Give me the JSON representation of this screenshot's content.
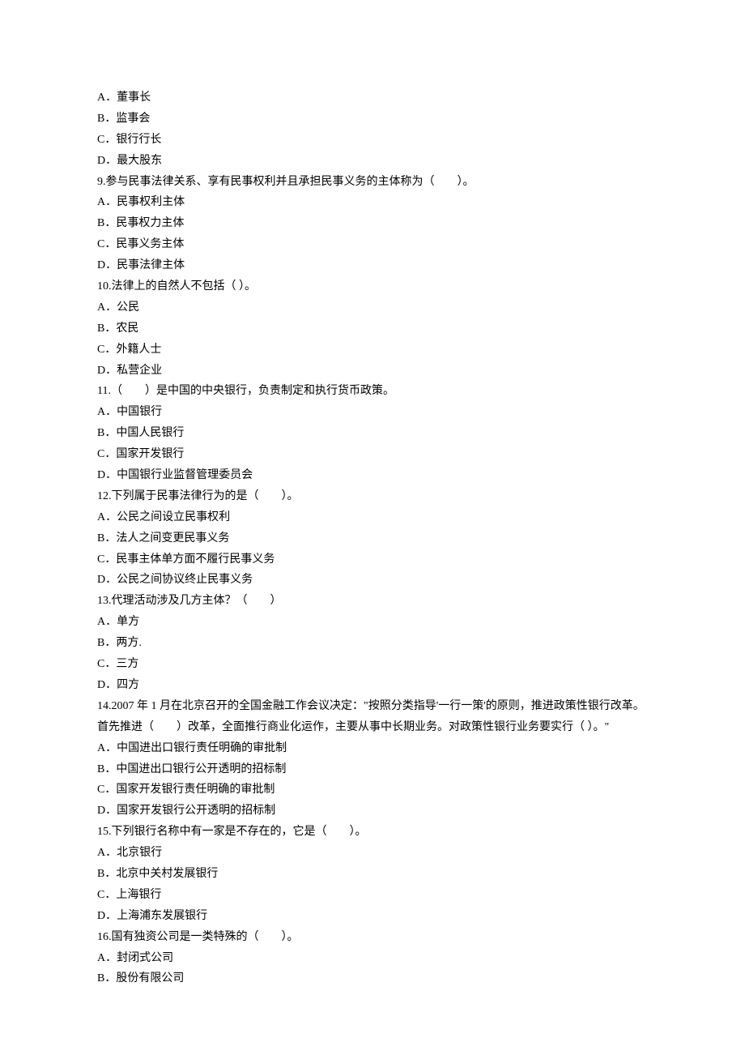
{
  "lines": [
    "A．董事长",
    "B．监事会",
    "C．银行行长",
    "D．最大股东",
    "9.参与民事法律关系、享有民事权利并且承担民事义务的主体称为（　　）。",
    "A．民事权利主体",
    "B．民事权力主体",
    "C．民事义务主体",
    "D．民事法律主体",
    "10.法律上的自然人不包括（ ）。",
    "A．公民",
    "B．农民",
    "C．外籍人士",
    "D．私营企业",
    "11.（　　）是中国的中央银行，负责制定和执行货币政策。",
    "A．中国银行",
    "B．中国人民银行",
    "C．国家开发银行",
    "D．中国银行业监督管理委员会",
    "12.下列属于民事法律行为的是（　　）。",
    "A．公民之间设立民事权利",
    "B．法人之间变更民事义务",
    "C．民事主体单方面不履行民事义务",
    "D．公民之间协议终止民事义务",
    "13.代理活动涉及几方主体？（　　）",
    "A．单方",
    "B．两方.",
    "C．三方",
    "D．四方",
    "14.2007 年 1 月在北京召开的全国金融工作会议决定：\"按照分类指导'一行一策'的原则，推进政策性银行改革。首先推进（　　）改革，全面推行商业化运作，主要从事中长期业务。对政策性银行业务要实行（ ）。\"",
    "A．中国进出口银行责任明确的审批制",
    "B．中国进出口银行公开透明的招标制",
    "C．国家开发银行责任明确的审批制",
    "D．国家开发银行公开透明的招标制",
    "15.下列银行名称中有一家是不存在的，它是（　　）。",
    "A．北京银行",
    "B．北京中关村发展银行",
    "C．上海银行",
    "D．上海浦东发展银行",
    "16.国有独资公司是一类特殊的（　　）。",
    "A．封闭式公司",
    "B．股份有限公司"
  ]
}
